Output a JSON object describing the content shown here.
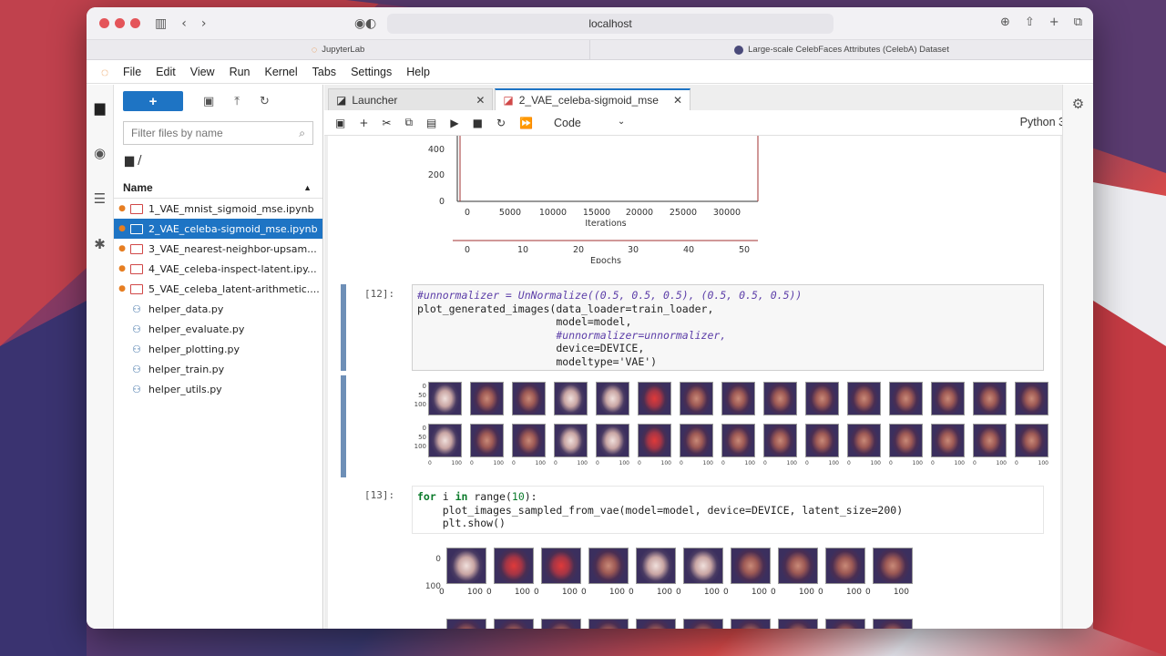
{
  "browser": {
    "url": "localhost",
    "tab_left": "JupyterLab",
    "tab_right": "Large-scale CelebFaces Attributes (CelebA) Dataset"
  },
  "menu": [
    "File",
    "Edit",
    "View",
    "Run",
    "Kernel",
    "Tabs",
    "Settings",
    "Help"
  ],
  "sidebar": {
    "new_label": "+",
    "filter_placeholder": "Filter files by name",
    "breadcrumb": "/",
    "column_name": "Name",
    "files": [
      {
        "name": "1_VAE_mnist_sigmoid_mse.ipynb",
        "type": "notebook",
        "running": true,
        "selected": false
      },
      {
        "name": "2_VAE_celeba-sigmoid_mse.ipynb",
        "type": "notebook",
        "running": true,
        "selected": true
      },
      {
        "name": "3_VAE_nearest-neighbor-upsam...",
        "type": "notebook",
        "running": true,
        "selected": false
      },
      {
        "name": "4_VAE_celeba-inspect-latent.ipy...",
        "type": "notebook",
        "running": true,
        "selected": false
      },
      {
        "name": "5_VAE_celeba_latent-arithmetic....",
        "type": "notebook",
        "running": true,
        "selected": false
      },
      {
        "name": "helper_data.py",
        "type": "python",
        "running": false,
        "selected": false
      },
      {
        "name": "helper_evaluate.py",
        "type": "python",
        "running": false,
        "selected": false
      },
      {
        "name": "helper_plotting.py",
        "type": "python",
        "running": false,
        "selected": false
      },
      {
        "name": "helper_train.py",
        "type": "python",
        "running": false,
        "selected": false
      },
      {
        "name": "helper_utils.py",
        "type": "python",
        "running": false,
        "selected": false
      }
    ]
  },
  "doc_tabs": [
    {
      "label": "Launcher",
      "active": false
    },
    {
      "label": "2_VAE_celeba-sigmoid_mse",
      "active": true
    }
  ],
  "toolbar": {
    "cell_type": "Code",
    "kernel": "Python 3"
  },
  "plot": {
    "y_ticks": [
      "400",
      "200",
      "0"
    ],
    "x_ticks": [
      "0",
      "5000",
      "10000",
      "15000",
      "20000",
      "25000",
      "30000"
    ],
    "xlabel": "Iterations",
    "epoch_ticks": [
      "0",
      "10",
      "20",
      "30",
      "40",
      "50"
    ],
    "epoch_label": "Epochs"
  },
  "cells": [
    {
      "prompt": "[12]:",
      "lines": [
        "#unnormalizer = UnNormalize((0.5, 0.5, 0.5), (0.5, 0.5, 0.5))",
        "plot_generated_images(data_loader=train_loader,",
        "                      model=model,",
        "                      #unnormalizer=unnormalizer,",
        "                      device=DEVICE,",
        "                      modeltype='VAE')"
      ]
    },
    {
      "prompt": "[13]:",
      "lines": [
        "for i in range(10):",
        "    plot_images_sampled_from_vae(model=model, device=DEVICE, latent_size=200)",
        "    plt.show()"
      ]
    }
  ],
  "face_grid": {
    "y_ticks_top": [
      "0",
      "50",
      "100"
    ],
    "y_ticks_bottom": [
      "0",
      "50",
      "100"
    ],
    "x_tick": [
      "0",
      "100"
    ],
    "columns": 15
  },
  "sampled_row": {
    "y_ticks": [
      "0",
      "100"
    ],
    "x_ticks": [
      "0",
      "100"
    ],
    "count": 10
  }
}
